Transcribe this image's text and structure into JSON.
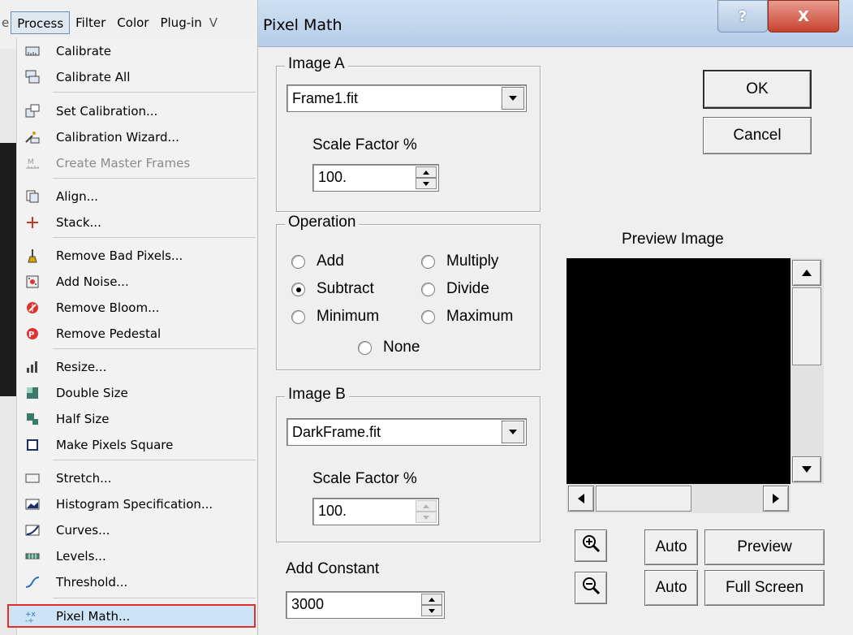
{
  "menubar": {
    "stub_left": "e",
    "items": [
      "Process",
      "Filter",
      "Color",
      "Plug-in"
    ],
    "stub_right": "V"
  },
  "menu": [
    {
      "label": "Calibrate",
      "icon": "calibrate-icon"
    },
    {
      "label": "Calibrate All",
      "icon": "calibrate-all-icon"
    },
    {
      "label": "Set Calibration...",
      "icon": "set-calibration-icon"
    },
    {
      "label": "Calibration Wizard...",
      "icon": "calibration-wizard-icon"
    },
    {
      "label": "Create Master Frames",
      "icon": "master-frames-icon",
      "disabled": true
    },
    {
      "label": "Align...",
      "icon": "align-icon"
    },
    {
      "label": "Stack...",
      "icon": "plus-icon"
    },
    {
      "label": "Remove Bad Pixels...",
      "icon": "broom-icon"
    },
    {
      "label": "Add Noise...",
      "icon": "noise-icon"
    },
    {
      "label": "Remove Bloom...",
      "icon": "remove-bloom-icon"
    },
    {
      "label": "Remove Pedestal",
      "icon": "remove-pedestal-icon"
    },
    {
      "label": "Resize...",
      "icon": "resize-icon"
    },
    {
      "label": "Double Size",
      "icon": "double-size-icon"
    },
    {
      "label": "Half Size",
      "icon": "half-size-icon"
    },
    {
      "label": "Make Pixels Square",
      "icon": "square-icon"
    },
    {
      "label": "Stretch...",
      "icon": "stretch-icon"
    },
    {
      "label": "Histogram Specification...",
      "icon": "histogram-icon"
    },
    {
      "label": "Curves...",
      "icon": "curves-icon"
    },
    {
      "label": "Levels...",
      "icon": "levels-icon"
    },
    {
      "label": "Threshold...",
      "icon": "threshold-icon"
    },
    {
      "label": "Pixel Math...",
      "icon": "pixel-math-icon"
    }
  ],
  "dialog": {
    "title": "Pixel Math",
    "help": "?",
    "close": "X",
    "image_a": {
      "legend": "Image A",
      "file": "Frame1.fit",
      "scale_label": "Scale Factor %",
      "scale": "100."
    },
    "operation": {
      "legend": "Operation",
      "options": [
        "Add",
        "Multiply",
        "Subtract",
        "Divide",
        "Minimum",
        "Maximum",
        "None"
      ],
      "selected": "Subtract"
    },
    "image_b": {
      "legend": "Image B",
      "file": "DarkFrame.fit",
      "scale_label": "Scale Factor %",
      "scale": "100."
    },
    "add_constant": {
      "label": "Add Constant",
      "value": "3000"
    },
    "ok": "OK",
    "cancel": "Cancel",
    "preview_label": "Preview Image",
    "auto1": "Auto",
    "auto2": "Auto",
    "preview_btn": "Preview",
    "fullscreen_btn": "Full Screen"
  }
}
